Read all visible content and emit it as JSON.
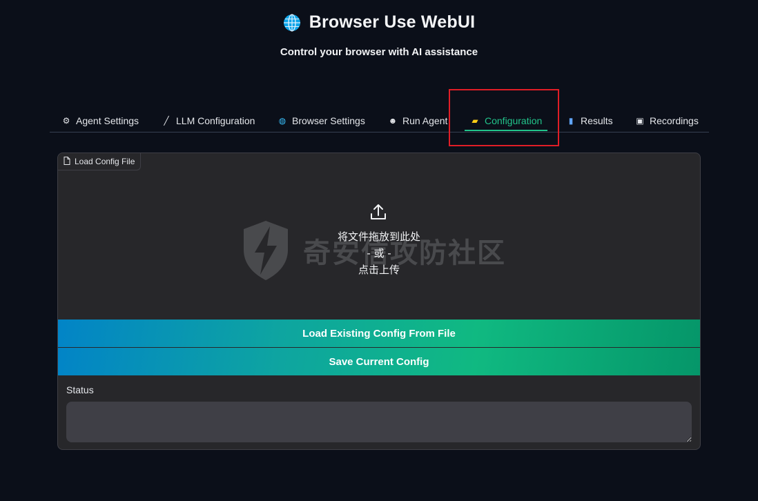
{
  "header": {
    "title": "Browser Use WebUI",
    "subtitle": "Control your browser with AI assistance",
    "title_icon": "globe-icon"
  },
  "tabs": [
    {
      "label": "Agent Settings",
      "icon": "gear-icon",
      "glyph": "⚙"
    },
    {
      "label": "LLM Configuration",
      "icon": "wand-icon",
      "glyph": "╱"
    },
    {
      "label": "Browser Settings",
      "icon": "globe-icon",
      "glyph": "◍"
    },
    {
      "label": "Run Agent",
      "icon": "robot-icon",
      "glyph": "☻"
    },
    {
      "label": "Configuration",
      "icon": "folder-icon",
      "glyph": "▰",
      "active": true
    },
    {
      "label": "Results",
      "icon": "bar-chart-icon",
      "glyph": "▮"
    },
    {
      "label": "Recordings",
      "icon": "camera-icon",
      "glyph": "▣"
    }
  ],
  "upload": {
    "label": "Load Config File",
    "drop_text": "将文件拖放到此处",
    "or_text": "- 或 -",
    "click_text": "点击上传"
  },
  "watermark": {
    "text": "奇安信攻防社区"
  },
  "buttons": {
    "load": "Load Existing Config From File",
    "save": "Save Current Config"
  },
  "status": {
    "label": "Status",
    "value": ""
  },
  "colors": {
    "accent": "#22c58b",
    "highlight": "#e11d26",
    "background": "#0b0f19",
    "panel": "#27272a"
  }
}
